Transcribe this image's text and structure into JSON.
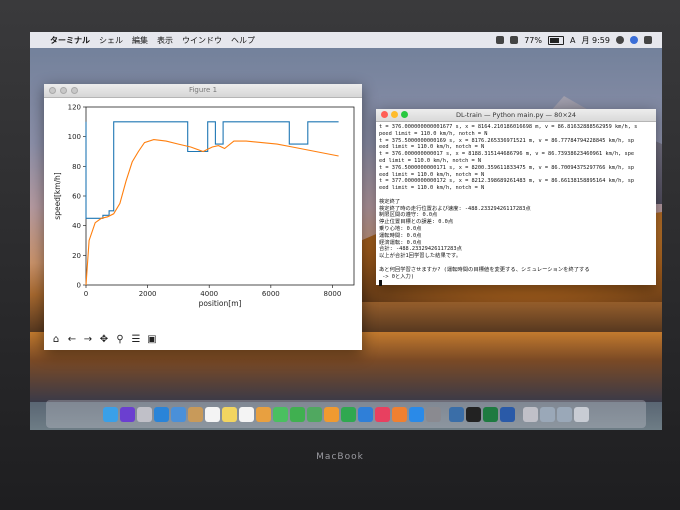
{
  "menubar": {
    "apple": "",
    "items": [
      "ターミナル",
      "シェル",
      "編集",
      "表示",
      "ウインドウ",
      "ヘルプ"
    ],
    "battery": "77%",
    "input_mode": "A",
    "clock": "月 9:59"
  },
  "figure": {
    "title": "Figure 1",
    "toolbar_icons": [
      "home-icon",
      "back-arrow-icon",
      "forward-arrow-icon",
      "pan-icon",
      "zoom-icon",
      "configure-subplots-icon",
      "save-icon"
    ]
  },
  "chart_data": {
    "type": "line",
    "title": "",
    "xlabel": "position[m]",
    "ylabel": "speed[km/h]",
    "xlim": [
      0,
      8700
    ],
    "ylim": [
      0,
      120
    ],
    "xticks": [
      0,
      2000,
      4000,
      6000,
      8000
    ],
    "yticks": [
      0,
      20,
      40,
      60,
      80,
      100,
      120
    ],
    "grid": false,
    "series": [
      {
        "color": "#1f77b4",
        "x": [
          0,
          0,
          30,
          30,
          550,
          550,
          750,
          750,
          900,
          900,
          1000,
          1000,
          3300,
          3300,
          3950,
          3950,
          4200,
          4200,
          4450,
          4450,
          4700,
          4700,
          6600,
          6600,
          7200,
          7200,
          8200
        ],
        "y": [
          110,
          45,
          45,
          45,
          45,
          47,
          47,
          50,
          50,
          110,
          110,
          110,
          110,
          90,
          90,
          110,
          110,
          95,
          95,
          110,
          110,
          110,
          110,
          95,
          95,
          110,
          110
        ]
      },
      {
        "color": "#ff7f0e",
        "x": [
          0,
          100,
          300,
          500,
          700,
          900,
          1100,
          1300,
          1500,
          1700,
          1900,
          2200,
          2600,
          3000,
          3400,
          3800,
          4100,
          4300,
          4500,
          4800,
          5200,
          5700,
          6200,
          6700,
          7200,
          7700,
          8200
        ],
        "y": [
          0,
          30,
          42,
          45,
          46,
          48,
          55,
          70,
          83,
          90,
          96,
          98,
          97,
          95,
          93,
          90,
          93,
          94,
          92,
          97,
          97,
          96,
          95,
          93,
          91,
          89,
          87
        ]
      }
    ]
  },
  "terminal": {
    "title": "DL-train — Python main.py — 80×24",
    "lines": [
      "t = 376.000000000001677 s, x = 8164.210186016698 m, v = 86.81632888562959 km/h, s",
      "peed limit = 110.0 km/h, notch = N",
      "t = 375.5000000000169 s, x = 8176.265336971521 m, v = 86.77784794228845 km/h, sp",
      "eed limit = 110.0 km/h, notch = N",
      "t = 376.000000000017 s, x = 8188.315144686796 m, v = 86.73938623460961 km/h, spe",
      "ed limit = 110.0 km/h, notch = N",
      "t = 376.5000000000171 s, x = 8200.359611833475 m, v = 86.70094375297766 km/h, sp",
      "eed limit = 110.0 km/h, notch = N",
      "t = 377.0000000000172 s, x = 8212.398689261483 m, v = 86.66138158895164 km/h, sp",
      "eed limit = 110.0 km/h, notch = N",
      "",
      "検定終了",
      "検定終了時の走行位置および速度: -488.23329426117283点",
      "制限区間の遵守: 0.0点",
      "停止位置目標との誤差: 0.0点",
      "乗り心地: 0.0点",
      "運転時間: 0.0点",
      "経済運転: 0.0点",
      "合計: -488.23329426117283点",
      "以上が合計1回学習した結果です。",
      "",
      "あと何回学習させますか? (運転時間の目標値を変更する、シミュレーションを終了する",
      " -> 0と入力)"
    ]
  },
  "dock": {
    "icons": [
      "finder-icon",
      "siri-icon",
      "launchpad-icon",
      "safari-icon",
      "mail-icon",
      "contacts-icon",
      "calendar-icon",
      "notes-icon",
      "reminders-icon",
      "photos-icon",
      "messages-icon",
      "facetime-icon",
      "maps-icon",
      "pages-icon",
      "numbers-icon",
      "keynote-icon",
      "music-icon",
      "books-icon",
      "app-store-icon",
      "system-preferences-icon",
      "python-icon",
      "terminal-icon",
      "excel-icon",
      "word-icon",
      "preview-icon",
      "folder-icon",
      "folder-icon",
      "trash-icon"
    ],
    "colors": [
      "#3aa0e8",
      "#6b3fd0",
      "#c0c0c8",
      "#2a84d8",
      "#4a90d9",
      "#c89a5a",
      "#f4f4f4",
      "#f2d560",
      "#f4f4f4",
      "#e8a040",
      "#4ac060",
      "#40b050",
      "#50a860",
      "#f09a30",
      "#30a850",
      "#2f7fd8",
      "#e84060",
      "#f08030",
      "#2a8ae8",
      "#8a8a90",
      "#3a6ea8",
      "#222222",
      "#1e7a40",
      "#2a5aa8",
      "#c0c0c8",
      "#9aa8b8",
      "#9aa8b8",
      "#c8ccd4"
    ]
  },
  "device_label": "MacBook"
}
